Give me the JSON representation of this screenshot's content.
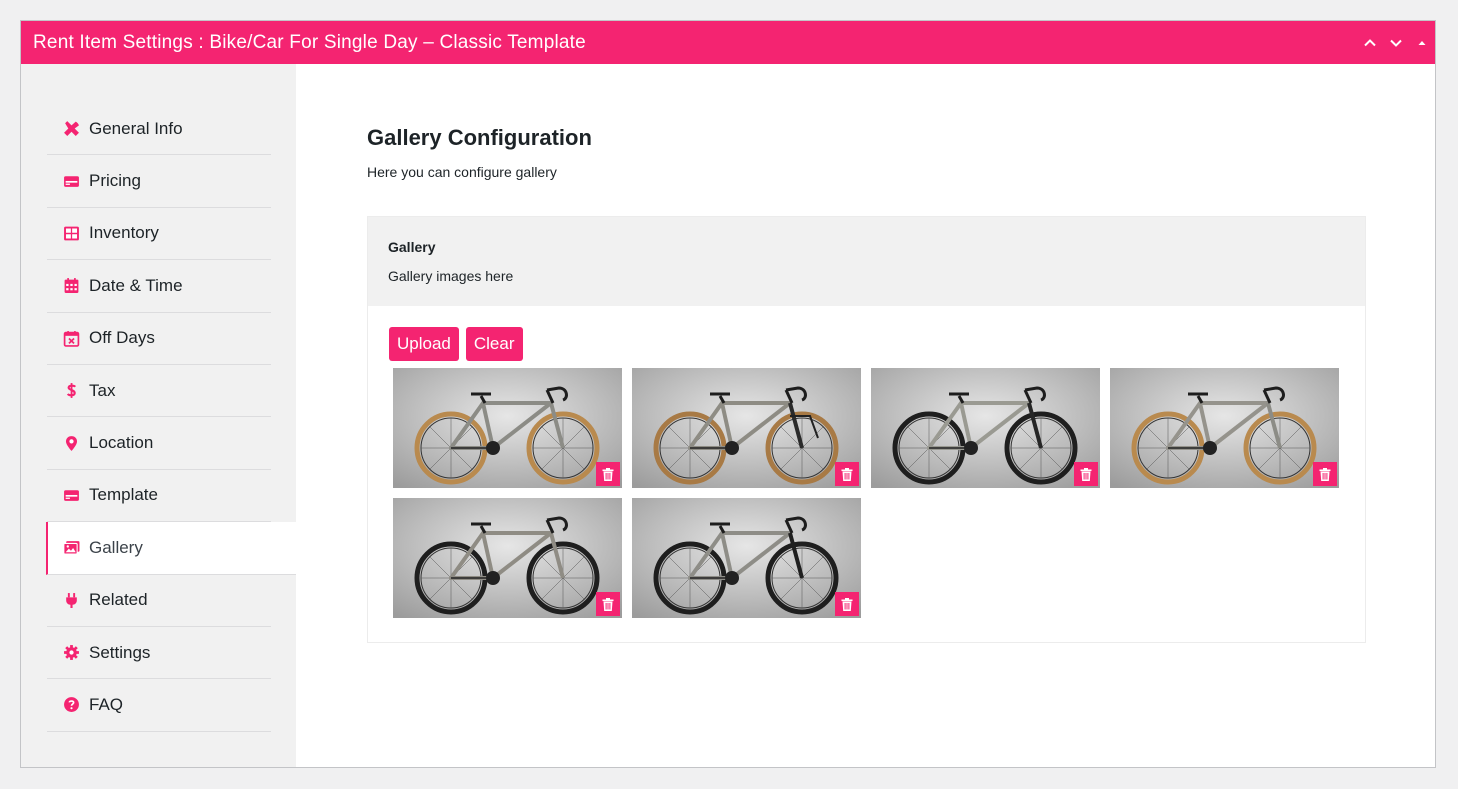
{
  "header": {
    "title": "Rent Item Settings : Bike/Car For Single Day – Classic Template",
    "accent_color": "#f42471"
  },
  "sidebar": {
    "items": [
      {
        "label": "General Info",
        "icon": "tools-icon"
      },
      {
        "label": "Pricing",
        "icon": "card-icon"
      },
      {
        "label": "Inventory",
        "icon": "grid-icon"
      },
      {
        "label": "Date & Time",
        "icon": "calendar-icon"
      },
      {
        "label": "Off Days",
        "icon": "calendar-x-icon"
      },
      {
        "label": "Tax",
        "icon": "dollar-icon"
      },
      {
        "label": "Location",
        "icon": "map-pin-icon"
      },
      {
        "label": "Template",
        "icon": "card-icon"
      },
      {
        "label": "Gallery",
        "icon": "images-icon",
        "active": true
      },
      {
        "label": "Related",
        "icon": "plug-icon"
      },
      {
        "label": "Settings",
        "icon": "gear-icon"
      },
      {
        "label": "FAQ",
        "icon": "question-circle-icon"
      }
    ]
  },
  "main": {
    "title": "Gallery Configuration",
    "subtitle": "Here you can configure gallery",
    "gallery": {
      "heading": "Gallery",
      "description": "Gallery images here",
      "upload_label": "Upload",
      "clear_label": "Clear",
      "images": [
        {
          "name": "gravel-bike-tan-tires"
        },
        {
          "name": "ebike-with-rack"
        },
        {
          "name": "gravel-bike-black-fork"
        },
        {
          "name": "gravel-bike-blue-decal"
        },
        {
          "name": "titanium-gravel-bike"
        },
        {
          "name": "titanium-bike-black-fork"
        }
      ]
    }
  }
}
